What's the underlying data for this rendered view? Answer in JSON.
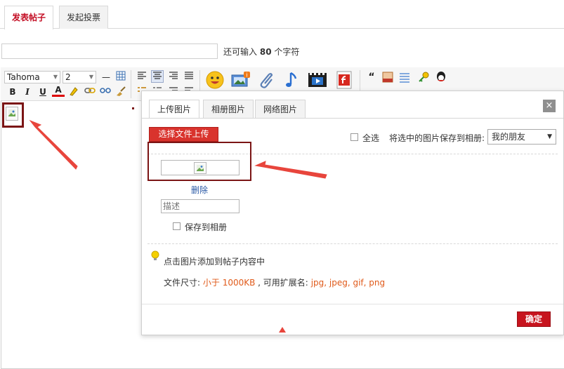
{
  "tabs": [
    {
      "label": "发表帖子",
      "active": true
    },
    {
      "label": "发起投票",
      "active": false
    }
  ],
  "subject": {
    "value": "",
    "hint_prefix": "还可输入",
    "hint_count": "80",
    "hint_suffix": "个字符"
  },
  "toolbar": {
    "font_family": "Tahoma",
    "font_size": "2",
    "bold": "B",
    "italic": "I",
    "underline": "U",
    "font_color": "A",
    "quote": "“"
  },
  "dialog": {
    "tabs": [
      {
        "label": "上传图片",
        "active": true
      },
      {
        "label": "相册图片",
        "active": false
      },
      {
        "label": "网络图片",
        "active": false
      }
    ],
    "close_symbol": "×",
    "upload_button": "选择文件上传",
    "select_all": "全选",
    "save_to_album_label": "将选中的图片保存到相册:",
    "album_selected": "我的朋友",
    "delete_link": "删除",
    "description_placeholder": "描述",
    "save_to_album_checkbox": "保存到相册",
    "tip": "点击图片添加到帖子内容中",
    "file_size_label": "文件尺寸:",
    "file_size_value": "小于 1000KB",
    "ext_label": ", 可用扩展名:",
    "ext_value": "jpg, jpeg, gif, png",
    "ok_button": "确定"
  },
  "colors": {
    "accent_red": "#c30d23",
    "annotation": "#7b1515",
    "arrow": "#e8453c",
    "orange_text": "#e05a1a"
  }
}
